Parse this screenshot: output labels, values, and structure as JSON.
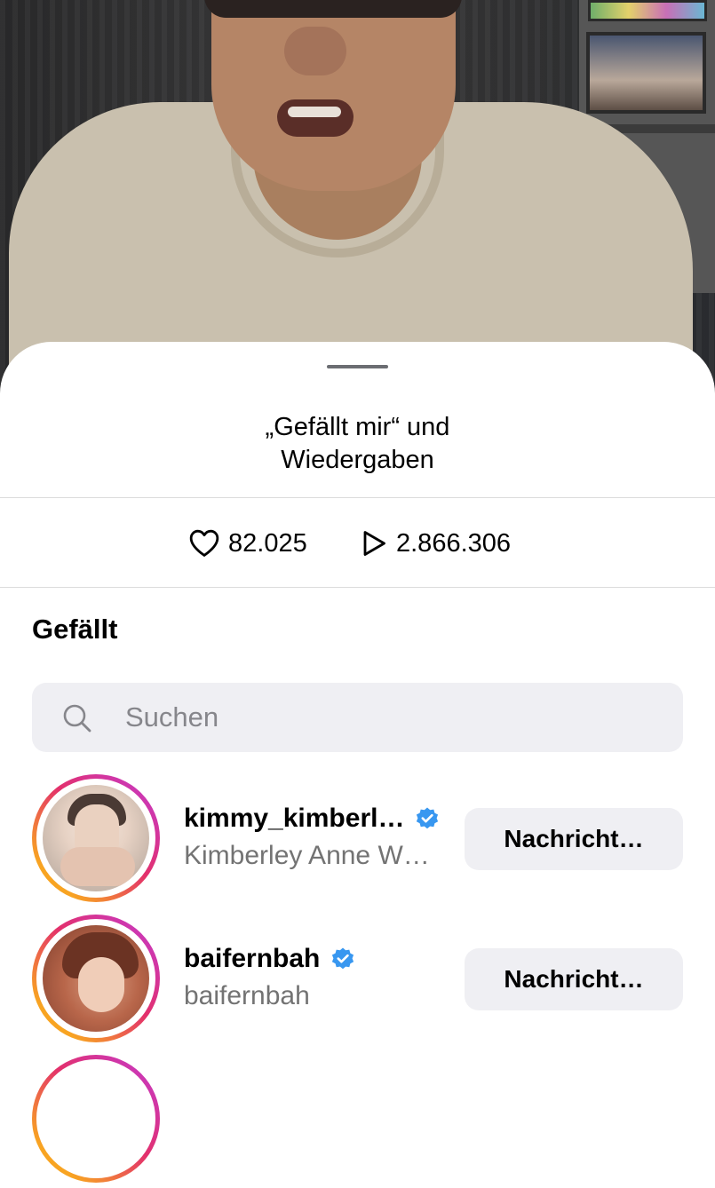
{
  "sheet": {
    "title_line1": "„Gefällt mir“ und",
    "title_line2": "Wiedergaben"
  },
  "stats": {
    "likes": "82.025",
    "plays": "2.866.306"
  },
  "likes_section": {
    "heading": "Gefällt"
  },
  "search": {
    "placeholder": "Suchen",
    "value": ""
  },
  "users": [
    {
      "username": "kimmy_kimberl…",
      "fullname": "Kimberley Anne W…",
      "verified": true,
      "button_label": "Nachricht…"
    },
    {
      "username": "baifernbah",
      "fullname": "baifernbah",
      "verified": true,
      "button_label": "Nachricht…"
    }
  ],
  "colors": {
    "verified_blue": "#3897f0",
    "search_bg": "#efeff3",
    "button_bg": "#efeff3",
    "secondary_text": "#737373",
    "story_ring_start": "#f8a422",
    "story_ring_end": "#c23bd4"
  },
  "icons": {
    "likes": "heart-outline-icon",
    "plays": "play-outline-icon",
    "search": "magnifier-icon",
    "verified": "verified-badge-icon"
  }
}
